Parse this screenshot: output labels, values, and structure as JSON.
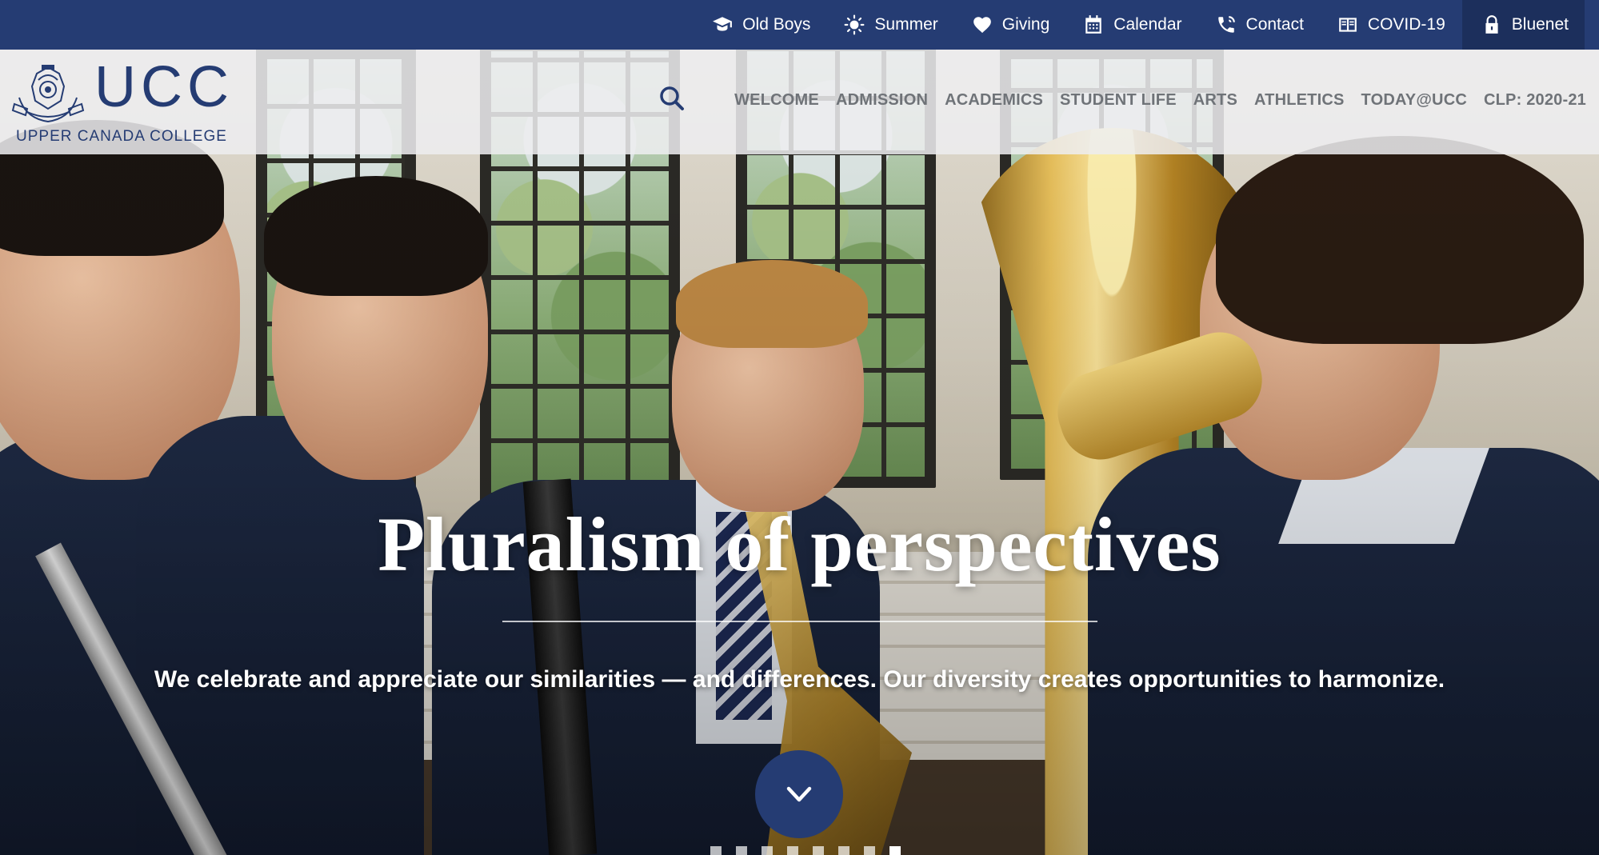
{
  "utility_nav": [
    {
      "label": "Old Boys",
      "icon": "graduation-cap-icon"
    },
    {
      "label": "Summer",
      "icon": "sun-icon"
    },
    {
      "label": "Giving",
      "icon": "heart-icon"
    },
    {
      "label": "Calendar",
      "icon": "calendar-icon"
    },
    {
      "label": "Contact",
      "icon": "phone-icon"
    },
    {
      "label": "COVID-19",
      "icon": "book-icon"
    },
    {
      "label": "Bluenet",
      "icon": "lock-icon"
    }
  ],
  "logo": {
    "wordmark": "UCC",
    "name": "UPPER CANADA COLLEGE"
  },
  "main_nav": [
    "WELCOME",
    "ADMISSION",
    "ACADEMICS",
    "STUDENT LIFE",
    "ARTS",
    "ATHLETICS",
    "TODAY@UCC",
    "CLP: 2020-21"
  ],
  "hero": {
    "title": "Pluralism of  perspectives",
    "subtitle": "We celebrate and appreciate our similarities — and differences. Our diversity creates opportunities to harmonize.",
    "slide_count": 8,
    "active_slide": 8
  },
  "colors": {
    "brand_navy": "#253c73",
    "utility_bar": "#253c73",
    "nav_text": "#6f7378"
  }
}
